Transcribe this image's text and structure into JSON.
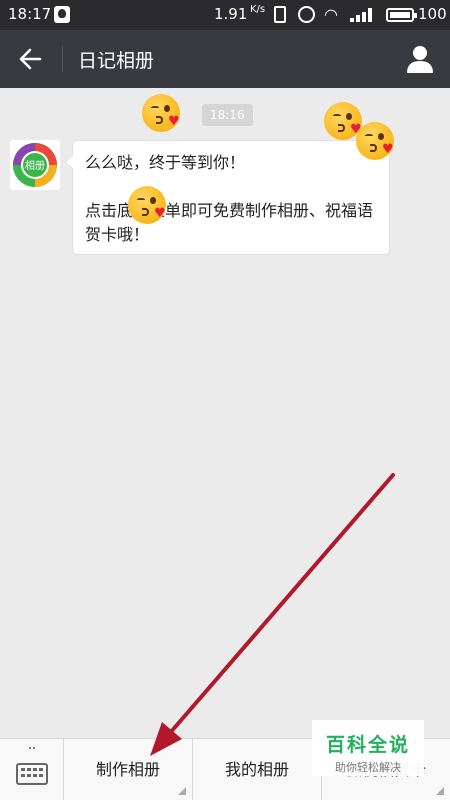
{
  "status_bar": {
    "time": "18:17",
    "net_speed": "1.91",
    "net_speed_unit": "K/s",
    "battery_level": "100",
    "battery_fraction": 1.0
  },
  "header": {
    "title": "日记相册",
    "back_icon": "arrow-left-icon",
    "profile_icon": "person-icon"
  },
  "chat": {
    "timestamp": "18:16",
    "avatar_text": "相册",
    "message_lines": [
      "么么哒，终于等到你！",
      "点击底部菜单即可免费制作相册、祝福语贺卡哦！"
    ]
  },
  "bottom_menu": {
    "keyboard_icon": "keyboard-icon",
    "items": [
      {
        "label": "制作相册"
      },
      {
        "label": "我的相册"
      },
      {
        "label": "微祝福贺卡"
      }
    ]
  },
  "watermark": {
    "title": "百科全说",
    "subtitle": "助你轻松解决"
  },
  "colors": {
    "status_bar": "#2b2b2d",
    "header": "#393a3f",
    "chat_bg": "#ebebeb",
    "arrow": "#b2182b",
    "watermark_green": "#21b05b"
  }
}
